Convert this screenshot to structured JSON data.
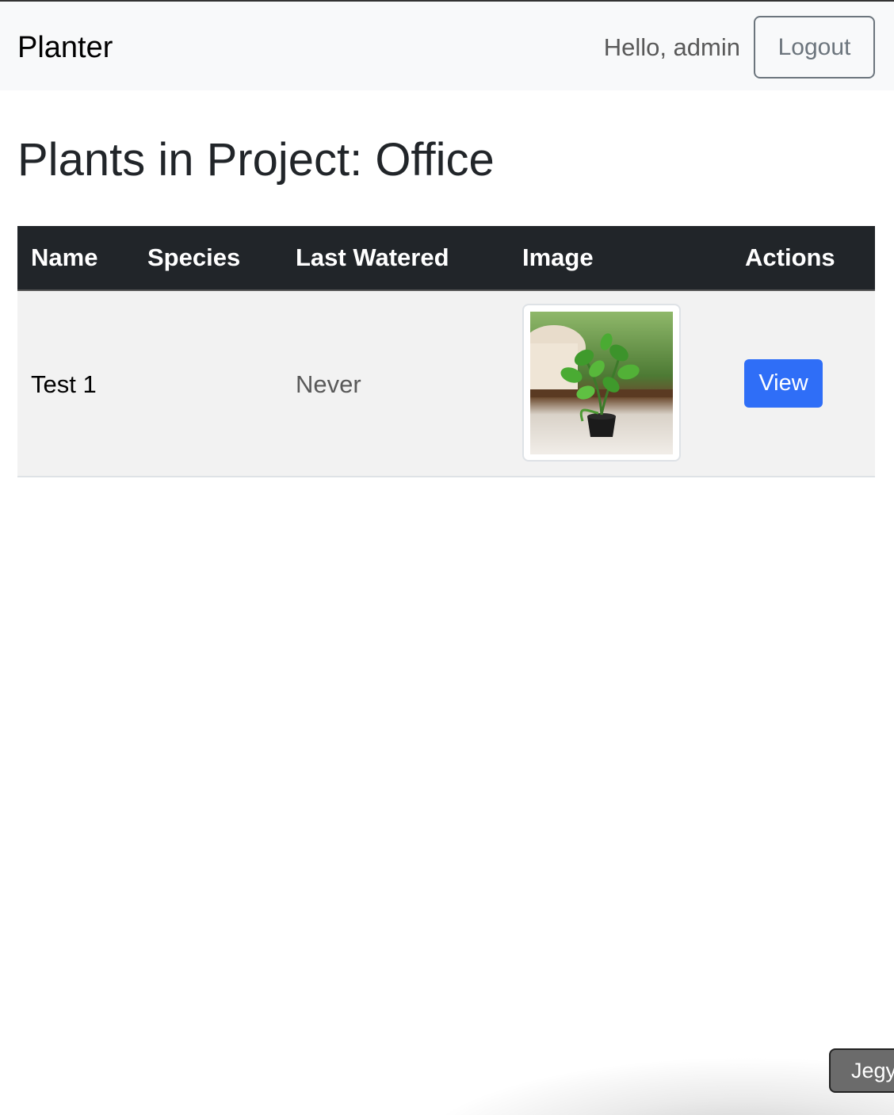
{
  "navbar": {
    "brand": "Planter",
    "greeting": "Hello, admin",
    "logout_label": "Logout"
  },
  "main": {
    "title": "Plants in Project: Office",
    "table": {
      "headers": [
        "Name",
        "Species",
        "Last Watered",
        "Image",
        "Actions"
      ],
      "rows": [
        {
          "name": "Test 1",
          "species": "",
          "last_watered": "Never",
          "image": "plant-photo",
          "action_label": "View"
        }
      ]
    }
  },
  "overlay": {
    "corner_button_label": "Jegy"
  },
  "colors": {
    "navbar_bg": "#f8f9fa",
    "table_header_bg": "#212529",
    "row_bg": "#f2f2f2",
    "primary": "#2f6ef7",
    "secondary": "#6c757d"
  }
}
